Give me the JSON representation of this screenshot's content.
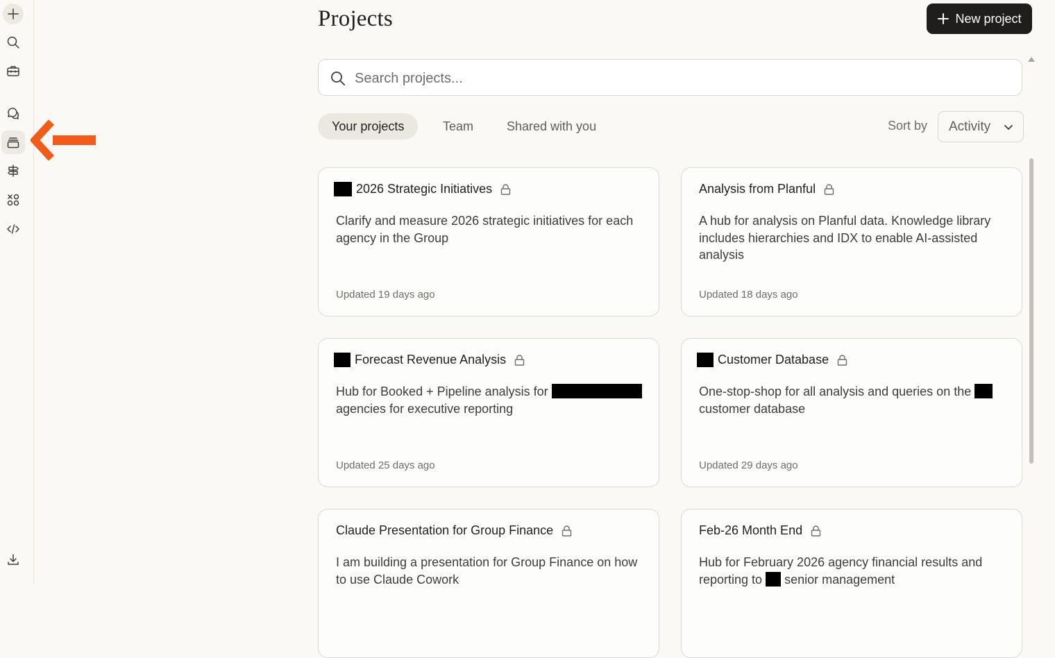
{
  "page": {
    "title": "Projects",
    "new_project_label": "New project"
  },
  "sidebar": {
    "items": [
      {
        "name": "new-chat",
        "icon": "plus-icon"
      },
      {
        "name": "search",
        "icon": "search-icon"
      },
      {
        "name": "tools",
        "icon": "toolbox-icon"
      },
      {
        "name": "chats",
        "icon": "chat-icon"
      },
      {
        "name": "projects",
        "icon": "projects-icon",
        "active": true
      },
      {
        "name": "artifacts",
        "icon": "signpost-icon"
      },
      {
        "name": "apps",
        "icon": "apps-icon"
      },
      {
        "name": "code",
        "icon": "code-icon"
      },
      {
        "name": "download",
        "icon": "download-icon"
      }
    ]
  },
  "search": {
    "placeholder": "Search projects..."
  },
  "tabs": [
    {
      "label": "Your projects",
      "active": true
    },
    {
      "label": "Team"
    },
    {
      "label": "Shared with you"
    }
  ],
  "sort": {
    "label": "Sort by",
    "value": "Activity"
  },
  "projects": [
    {
      "name": "2026 Strategic Initiatives",
      "desc_a": "Clarify and measure 2026 strategic initiatives for each agency in the Group",
      "desc_b": "",
      "updated": "Updated 19 days ago"
    },
    {
      "name": "Analysis from Planful",
      "desc_a": "A hub for analysis on Planful data. Knowledge library includes hierarchies and IDX to enable AI-assisted analysis",
      "desc_b": "",
      "updated": "Updated 18 days ago"
    },
    {
      "name": "Forecast Revenue Analysis",
      "desc_a": "Hub for Booked + Pipeline analysis for",
      "desc_b": "agencies for executive reporting",
      "updated": "Updated 25 days ago"
    },
    {
      "name": "Customer Database",
      "desc_a": "One-stop-shop for all analysis and queries on the",
      "desc_b": "customer database",
      "updated": "Updated 29 days ago"
    },
    {
      "name": "Claude Presentation for Group Finance",
      "desc_a": "I am building a presentation for Group Finance on how to use Claude Cowork",
      "desc_b": "",
      "updated": ""
    },
    {
      "name": "Feb-26 Month End",
      "desc_a": "Hub for February 2026 agency financial results and reporting to",
      "desc_b": "senior management",
      "updated": ""
    }
  ],
  "colors": {
    "accent_arrow": "#f25c1b",
    "button_dark": "#1f1e1d",
    "background": "#faf9f5"
  }
}
